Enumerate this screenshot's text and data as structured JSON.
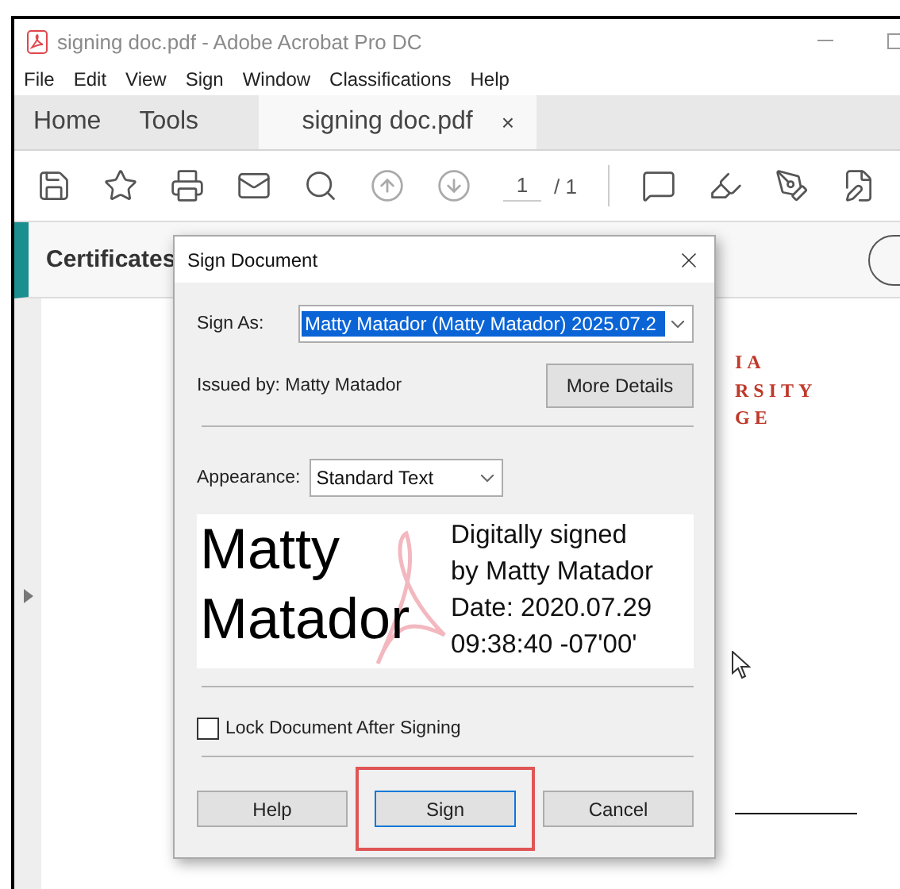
{
  "window": {
    "title": "signing doc.pdf - Adobe Acrobat Pro DC"
  },
  "menu": [
    "File",
    "Edit",
    "View",
    "Sign",
    "Window",
    "Classifications",
    "Help"
  ],
  "tabs": [
    {
      "label": "Home",
      "selected": false
    },
    {
      "label": "Tools",
      "selected": false
    },
    {
      "label": "signing doc.pdf",
      "selected": true,
      "close": "×"
    }
  ],
  "toolbar": {
    "page_current": "1",
    "page_total": "/ 1"
  },
  "certificates_bar": {
    "title": "Certificates"
  },
  "document": {
    "heading_lines": [
      "IA",
      "RSITY",
      "GE"
    ]
  },
  "dialog": {
    "title": "Sign Document",
    "sign_as_label": "Sign As:",
    "sign_as_value": "Matty Matador (Matty Matador) 2025.07.2",
    "issued_by": "Issued by: Matty Matador",
    "more_details": "More Details",
    "appearance_label": "Appearance:",
    "appearance_value": "Standard Text",
    "preview": {
      "name_lines": [
        "Matty",
        "Matador"
      ],
      "detail_lines": [
        "Digitally signed",
        "by Matty Matador",
        "Date: 2020.07.29",
        "09:38:40 -07'00'"
      ]
    },
    "lock": {
      "label": "Lock Document After Signing",
      "checked": false
    },
    "buttons": [
      {
        "label": "Help",
        "highlighted": false
      },
      {
        "label": "Sign",
        "highlighted": true
      },
      {
        "label": "Cancel",
        "highlighted": false
      }
    ]
  }
}
